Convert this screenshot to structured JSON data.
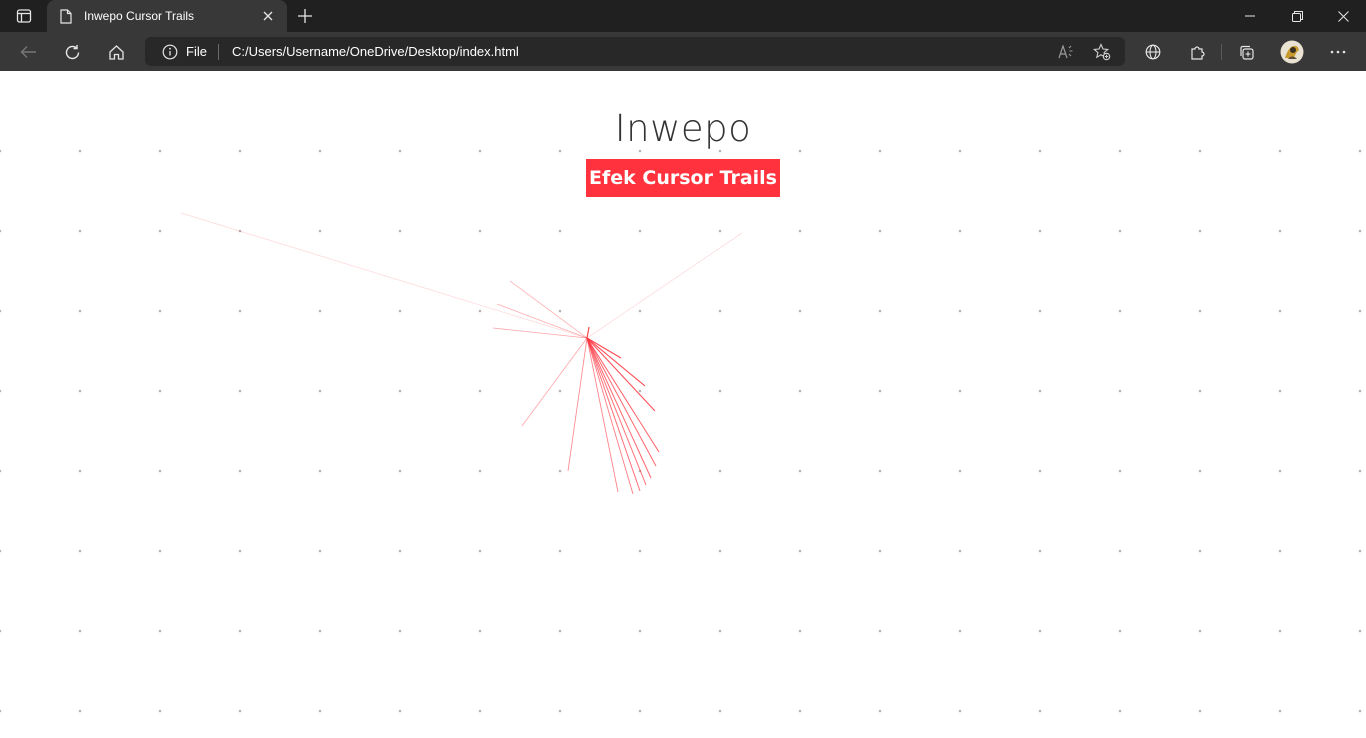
{
  "browser": {
    "tab_title": "Inwepo Cursor Trails",
    "address_scheme_label": "File",
    "address_url": "C:/Users/Username/OneDrive/Desktop/index.html",
    "icons": [
      "sidebar-icon",
      "page-icon",
      "close-icon",
      "new-tab-icon",
      "minimize-icon",
      "restore-icon",
      "window-close-icon",
      "back-icon",
      "refresh-icon",
      "home-icon",
      "info-icon",
      "read-aloud-icon",
      "favorites-icon",
      "globe-icon",
      "extensions-icon",
      "collections-icon",
      "avatar",
      "more-icon"
    ]
  },
  "page": {
    "heading": "Inwepo",
    "badge": "Efek Cursor Trails",
    "accent_color": "#ff323d",
    "dot_color": "#b4b4b4"
  }
}
